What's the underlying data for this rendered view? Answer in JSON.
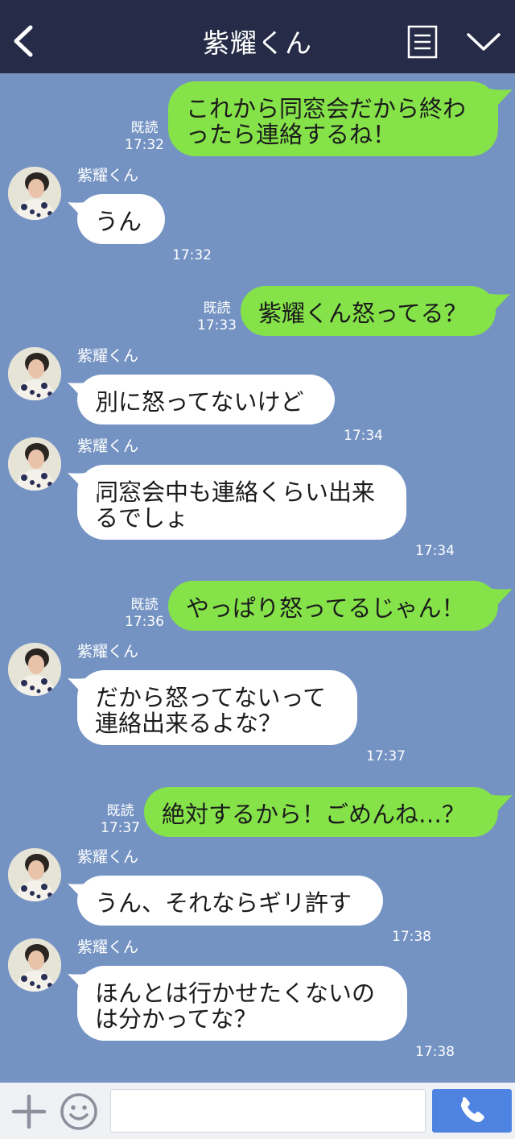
{
  "header": {
    "title": "紫耀くん",
    "back_icon": "chevron-left-icon",
    "menu_icon": "list-menu-icon",
    "chevron_icon": "chevron-down-icon"
  },
  "messages": [
    {
      "from": "me",
      "lines": [
        "これから同窓会だから終わ",
        "ったら連絡するね！"
      ],
      "read": "既読",
      "time": "17:32"
    },
    {
      "from": "them",
      "name": "紫耀くん",
      "lines": [
        "うん"
      ],
      "time": "17:32"
    },
    {
      "from": "me",
      "lines": [
        "紫耀くん怒ってる？"
      ],
      "read": "既読",
      "time": "17:33"
    },
    {
      "from": "them",
      "name": "紫耀くん",
      "lines": [
        "別に怒ってないけど"
      ],
      "time": "17:34"
    },
    {
      "from": "them",
      "name": "紫耀くん",
      "lines": [
        "同窓会中も連絡くらい出来",
        "るでしょ"
      ],
      "time": "17:34"
    },
    {
      "from": "me",
      "lines": [
        "やっぱり怒ってるじゃん！"
      ],
      "read": "既読",
      "time": "17:36"
    },
    {
      "from": "them",
      "name": "紫耀くん",
      "lines": [
        "だから怒ってないって",
        "連絡出来るよな？"
      ],
      "time": "17:37"
    },
    {
      "from": "me",
      "lines": [
        "絶対するから！ごめんね…？"
      ],
      "read": "既読",
      "time": "17:37"
    },
    {
      "from": "them",
      "name": "紫耀くん",
      "lines": [
        "うん、それならギリ許す"
      ],
      "time": "17:38"
    },
    {
      "from": "them",
      "name": "紫耀くん",
      "lines": [
        "ほんとは行かせたくないの",
        "は分かってな？"
      ],
      "time": "17:38"
    }
  ],
  "input": {
    "value": "",
    "placeholder": "",
    "plus_icon": "plus-icon",
    "emoji_icon": "smiley-icon",
    "call_icon": "phone-icon"
  },
  "colors": {
    "header_bg": "#262c47",
    "chat_bg": "#7493c3",
    "my_bubble": "#85e249",
    "their_bubble": "#ffffff",
    "call_button": "#4f83e2"
  }
}
